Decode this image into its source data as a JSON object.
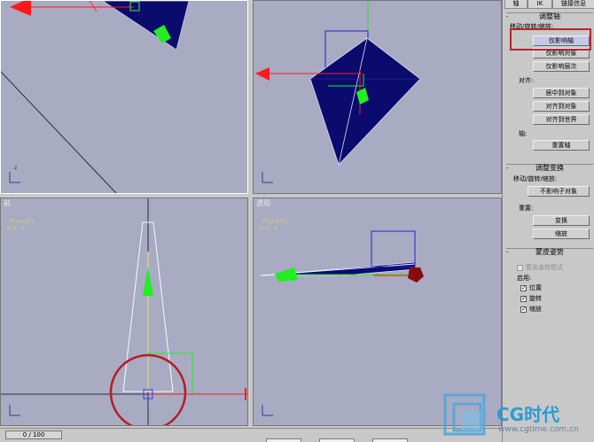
{
  "viewports": {
    "top_left": {
      "label": ""
    },
    "top_right": {
      "label": ""
    },
    "bottom_left": {
      "label": "前",
      "object": "Plane01",
      "tris": "Tris: 4"
    },
    "bottom_right": {
      "label": "透视",
      "object": "Plane01",
      "tris": "Tris: 4"
    }
  },
  "tabs": [
    "轴",
    "IK",
    "链接信息"
  ],
  "rollouts": {
    "adjust_pivot": {
      "title": "调整轴",
      "move_rotate_scale_label": "移动/旋转/缩放:",
      "affect_pivot_only": "仅影响轴",
      "affect_object_only": "仅影响对象",
      "affect_hierarchy_only": "仅影响层次",
      "align_label": "对齐:",
      "center_to_object": "居中到对象",
      "align_to_object": "对齐到对象",
      "align_to_world": "对齐到世界",
      "pivot_label": "轴:",
      "reset_pivot": "重置轴"
    },
    "adjust_transform": {
      "title": "调整变换",
      "move_rotate_scale_label": "移动/旋转/缩放:",
      "dont_affect_children": "不影响子对象",
      "reset_label": "重置:",
      "transform": "变换",
      "scale": "缩放"
    },
    "skin_pose": {
      "title": "蒙皮姿势",
      "skin_pose_mode": "蒙皮姿势模式",
      "enabled_label": "启用:",
      "position": "位置",
      "rotation": "旋转",
      "scale": "缩放"
    }
  },
  "timeline": {
    "frame": "0 / 100"
  },
  "watermark": {
    "brand": "CG时代",
    "url": "www.cgtime.com.cn"
  },
  "colors": {
    "viewport_bg": "#a8abc2",
    "object_fill": "#0b0b6e",
    "axis_x": "#ff1a1a",
    "axis_y": "#22ee22",
    "highlight": "#b3272b"
  }
}
